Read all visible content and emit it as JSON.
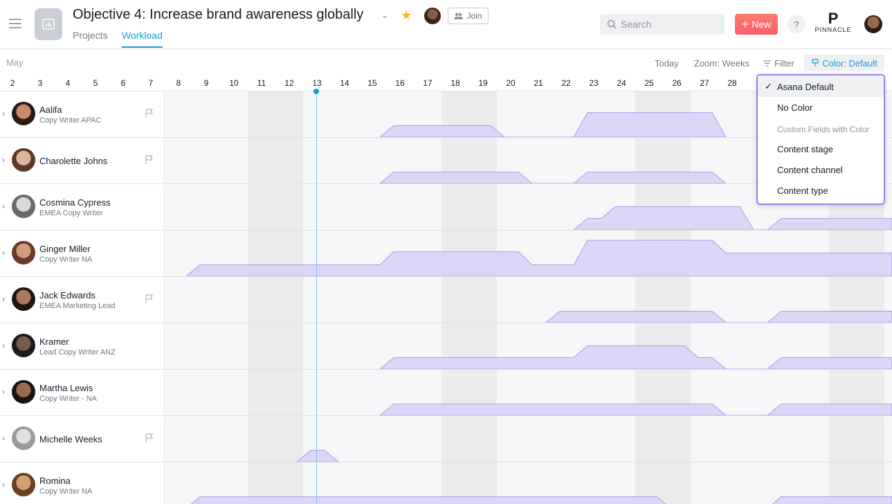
{
  "header": {
    "title": "Objective 4: Increase brand awareness globally",
    "tabs": [
      {
        "label": "Projects"
      },
      {
        "label": "Workload"
      }
    ],
    "join_label": "Join",
    "search_placeholder": "Search",
    "new_label": "New",
    "help_label": "?",
    "brand_mark": "P",
    "brand_name": "PINNACLE"
  },
  "toolbar": {
    "month": "May",
    "today": "Today",
    "zoom": "Zoom: Weeks",
    "filter": "Filter",
    "color": "Color: Default"
  },
  "dates": [
    "2",
    "3",
    "4",
    "5",
    "6",
    "7",
    "8",
    "9",
    "10",
    "11",
    "12",
    "13",
    "14",
    "15",
    "16",
    "17",
    "18",
    "19",
    "20",
    "21",
    "22",
    "23",
    "24",
    "25",
    "26",
    "27",
    "28"
  ],
  "people": [
    {
      "name": "Aalifa",
      "role": "Copy Writer APAC",
      "flag": true
    },
    {
      "name": "Charolette Johns",
      "role": "",
      "flag": true
    },
    {
      "name": "Cosmina Cypress",
      "role": "EMEA Copy Writer",
      "flag": false
    },
    {
      "name": "Ginger Miller",
      "role": "Copy Writer NA",
      "flag": false
    },
    {
      "name": "Jack Edwards",
      "role": "EMEA Marketing Lead",
      "flag": true
    },
    {
      "name": "Kramer",
      "role": "Lead Copy Writer ANZ",
      "flag": false
    },
    {
      "name": "Martha Lewis",
      "role": "Copy Writer - NA",
      "flag": false
    },
    {
      "name": "Michelle Weeks",
      "role": "",
      "flag": true
    },
    {
      "name": "Romina",
      "role": "Copy Writer NA",
      "flag": false
    }
  ],
  "color_menu": {
    "items": [
      {
        "label": "Asana Default",
        "selected": true
      },
      {
        "label": "No Color",
        "selected": false
      }
    ],
    "section": "Custom Fields with Color",
    "fields": [
      {
        "label": "Content stage"
      },
      {
        "label": "Content channel"
      },
      {
        "label": "Content type"
      }
    ],
    "check": "✓"
  },
  "colors": {
    "accent": "#1d9ad6",
    "new_button": "#fc636b",
    "workload_fill": "#dcd6f7",
    "workload_line": "#a99bea",
    "menu_border": "#9b7bf0",
    "star": "#f8b31c"
  }
}
